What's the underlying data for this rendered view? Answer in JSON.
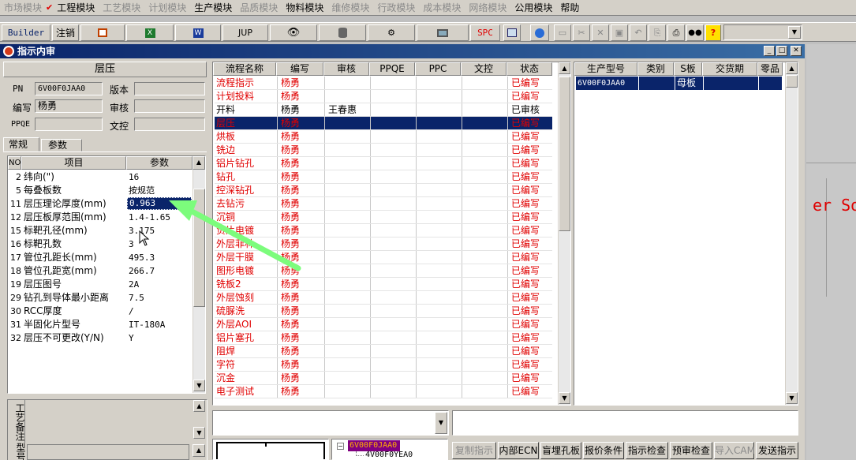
{
  "menu": [
    "市场模块",
    "工程模块",
    "工艺模块",
    "计划模块",
    "生产模块",
    "品质模块",
    "物料模块",
    "维修模块",
    "行政模块",
    "成本模块",
    "网络模块",
    "公用模块",
    "帮助"
  ],
  "toolbar": {
    "builder": "Builder",
    "logout": "注销",
    "jup": "JUP",
    "spc": "SPC",
    "combo_value": ""
  },
  "window": {
    "title": "指示内审"
  },
  "left": {
    "section_title": "层压",
    "pn_label": "PN",
    "pn_value": "6V00F0JAA0",
    "version_label": "版本",
    "version_value": "",
    "author_label": "编写",
    "author_value": "杨勇",
    "review_label": "审核",
    "review_value": "",
    "ppqe_label": "PPQE",
    "ppqe_value": "",
    "doc_label": "文控",
    "doc_value": "",
    "tab_general": "常规",
    "tab_params": "参数",
    "param_headers": {
      "no": "NO",
      "item": "项目",
      "param": "参数"
    },
    "params": [
      {
        "no": "2",
        "item": "纬向(\")",
        "value": "16"
      },
      {
        "no": "5",
        "item": "每叠板数",
        "value": "按规范"
      },
      {
        "no": "11",
        "item": "层压理论厚度(mm)",
        "value": "0.963"
      },
      {
        "no": "12",
        "item": "层压板厚范围(mm)",
        "value": "1.4-1.65"
      },
      {
        "no": "15",
        "item": "标靶孔径(mm)",
        "value": "3.175"
      },
      {
        "no": "16",
        "item": "标靶孔数",
        "value": "3"
      },
      {
        "no": "17",
        "item": "管位孔距长(mm)",
        "value": "495.3"
      },
      {
        "no": "18",
        "item": "管位孔距宽(mm)",
        "value": "266.7"
      },
      {
        "no": "19",
        "item": "层压图号",
        "value": "2A"
      },
      {
        "no": "29",
        "item": "钻孔到导体最小距离",
        "value": "7.5"
      },
      {
        "no": "30",
        "item": "RCC厚度",
        "value": "/"
      },
      {
        "no": "31",
        "item": "半固化片型号",
        "value": "IT-180A"
      },
      {
        "no": "32",
        "item": "层压不可更改(Y/N)",
        "value": "Y"
      }
    ],
    "remark_label": "工艺备注",
    "tail_label": "型号"
  },
  "flow": {
    "headers": {
      "name": "流程名称",
      "author": "编写",
      "review": "审核",
      "ppqe": "PPQE",
      "ppc": "PPC",
      "doc": "文控",
      "status": "状态"
    },
    "rows": [
      {
        "name": "流程指示",
        "author": "杨勇",
        "review": "",
        "status": "已编写"
      },
      {
        "name": "计划投料",
        "author": "杨勇",
        "review": "",
        "status": "已编写"
      },
      {
        "name": "开料",
        "author": "杨勇",
        "review": "王春惠",
        "status": "已审核"
      },
      {
        "name": "层压",
        "author": "杨勇",
        "review": "",
        "status": "已编写"
      },
      {
        "name": "烘板",
        "author": "杨勇",
        "review": "",
        "status": "已编写"
      },
      {
        "name": "铣边",
        "author": "杨勇",
        "review": "",
        "status": "已编写"
      },
      {
        "name": "铝片钻孔",
        "author": "杨勇",
        "review": "",
        "status": "已编写"
      },
      {
        "name": "钻孔",
        "author": "杨勇",
        "review": "",
        "status": "已编写"
      },
      {
        "name": "控深钻孔",
        "author": "杨勇",
        "review": "",
        "status": "已编写"
      },
      {
        "name": "去钻污",
        "author": "杨勇",
        "review": "",
        "status": "已编写"
      },
      {
        "name": "沉铜",
        "author": "杨勇",
        "review": "",
        "status": "已编写"
      },
      {
        "name": "负片电镀",
        "author": "杨勇",
        "review": "",
        "status": "已编写"
      },
      {
        "name": "外层菲林",
        "author": "杨勇",
        "review": "",
        "status": "已编写"
      },
      {
        "name": "外层干膜",
        "author": "杨勇",
        "review": "",
        "status": "已编写"
      },
      {
        "name": "图形电镀",
        "author": "杨勇",
        "review": "",
        "status": "已编写"
      },
      {
        "name": "铣板2",
        "author": "杨勇",
        "review": "",
        "status": "已编写"
      },
      {
        "name": "外层蚀刻",
        "author": "杨勇",
        "review": "",
        "status": "已编写"
      },
      {
        "name": "硫脲洗",
        "author": "杨勇",
        "review": "",
        "status": "已编写"
      },
      {
        "name": "外层AOI",
        "author": "杨勇",
        "review": "",
        "status": "已编写"
      },
      {
        "name": "铝片塞孔",
        "author": "杨勇",
        "review": "",
        "status": "已编写"
      },
      {
        "name": "阻焊",
        "author": "杨勇",
        "review": "",
        "status": "已编写"
      },
      {
        "name": "字符",
        "author": "杨勇",
        "review": "",
        "status": "已编写"
      },
      {
        "name": "沉金",
        "author": "杨勇",
        "review": "",
        "status": "已编写"
      },
      {
        "name": "电子测试",
        "author": "杨勇",
        "review": "",
        "status": "已编写"
      }
    ]
  },
  "prod": {
    "headers": {
      "model": "生产型号",
      "category": "类别",
      "sboard": "S板",
      "due": "交货期",
      "sample": "零品"
    },
    "rows": [
      {
        "model": "6V00F0JAA0",
        "category": "",
        "sboard": "母板",
        "due": "",
        "sample": ""
      }
    ]
  },
  "tree": {
    "root": "6V00F0JAA0",
    "child": "4V00F0YEA0"
  },
  "bg_text": "er So",
  "buttons": [
    {
      "label": "复制指示",
      "enabled": false
    },
    {
      "label": "内部ECN",
      "enabled": true
    },
    {
      "label": "盲埋孔板",
      "enabled": true
    },
    {
      "label": "报价条件",
      "enabled": true
    },
    {
      "label": "指示检查",
      "enabled": true
    },
    {
      "label": "预审检查",
      "enabled": true
    },
    {
      "label": "导入CAM",
      "enabled": false
    },
    {
      "label": "发送指示",
      "enabled": true
    }
  ],
  "colors": {
    "selection": "#0a246a",
    "written": "#e00000",
    "arrow": "#7cfc7c"
  }
}
